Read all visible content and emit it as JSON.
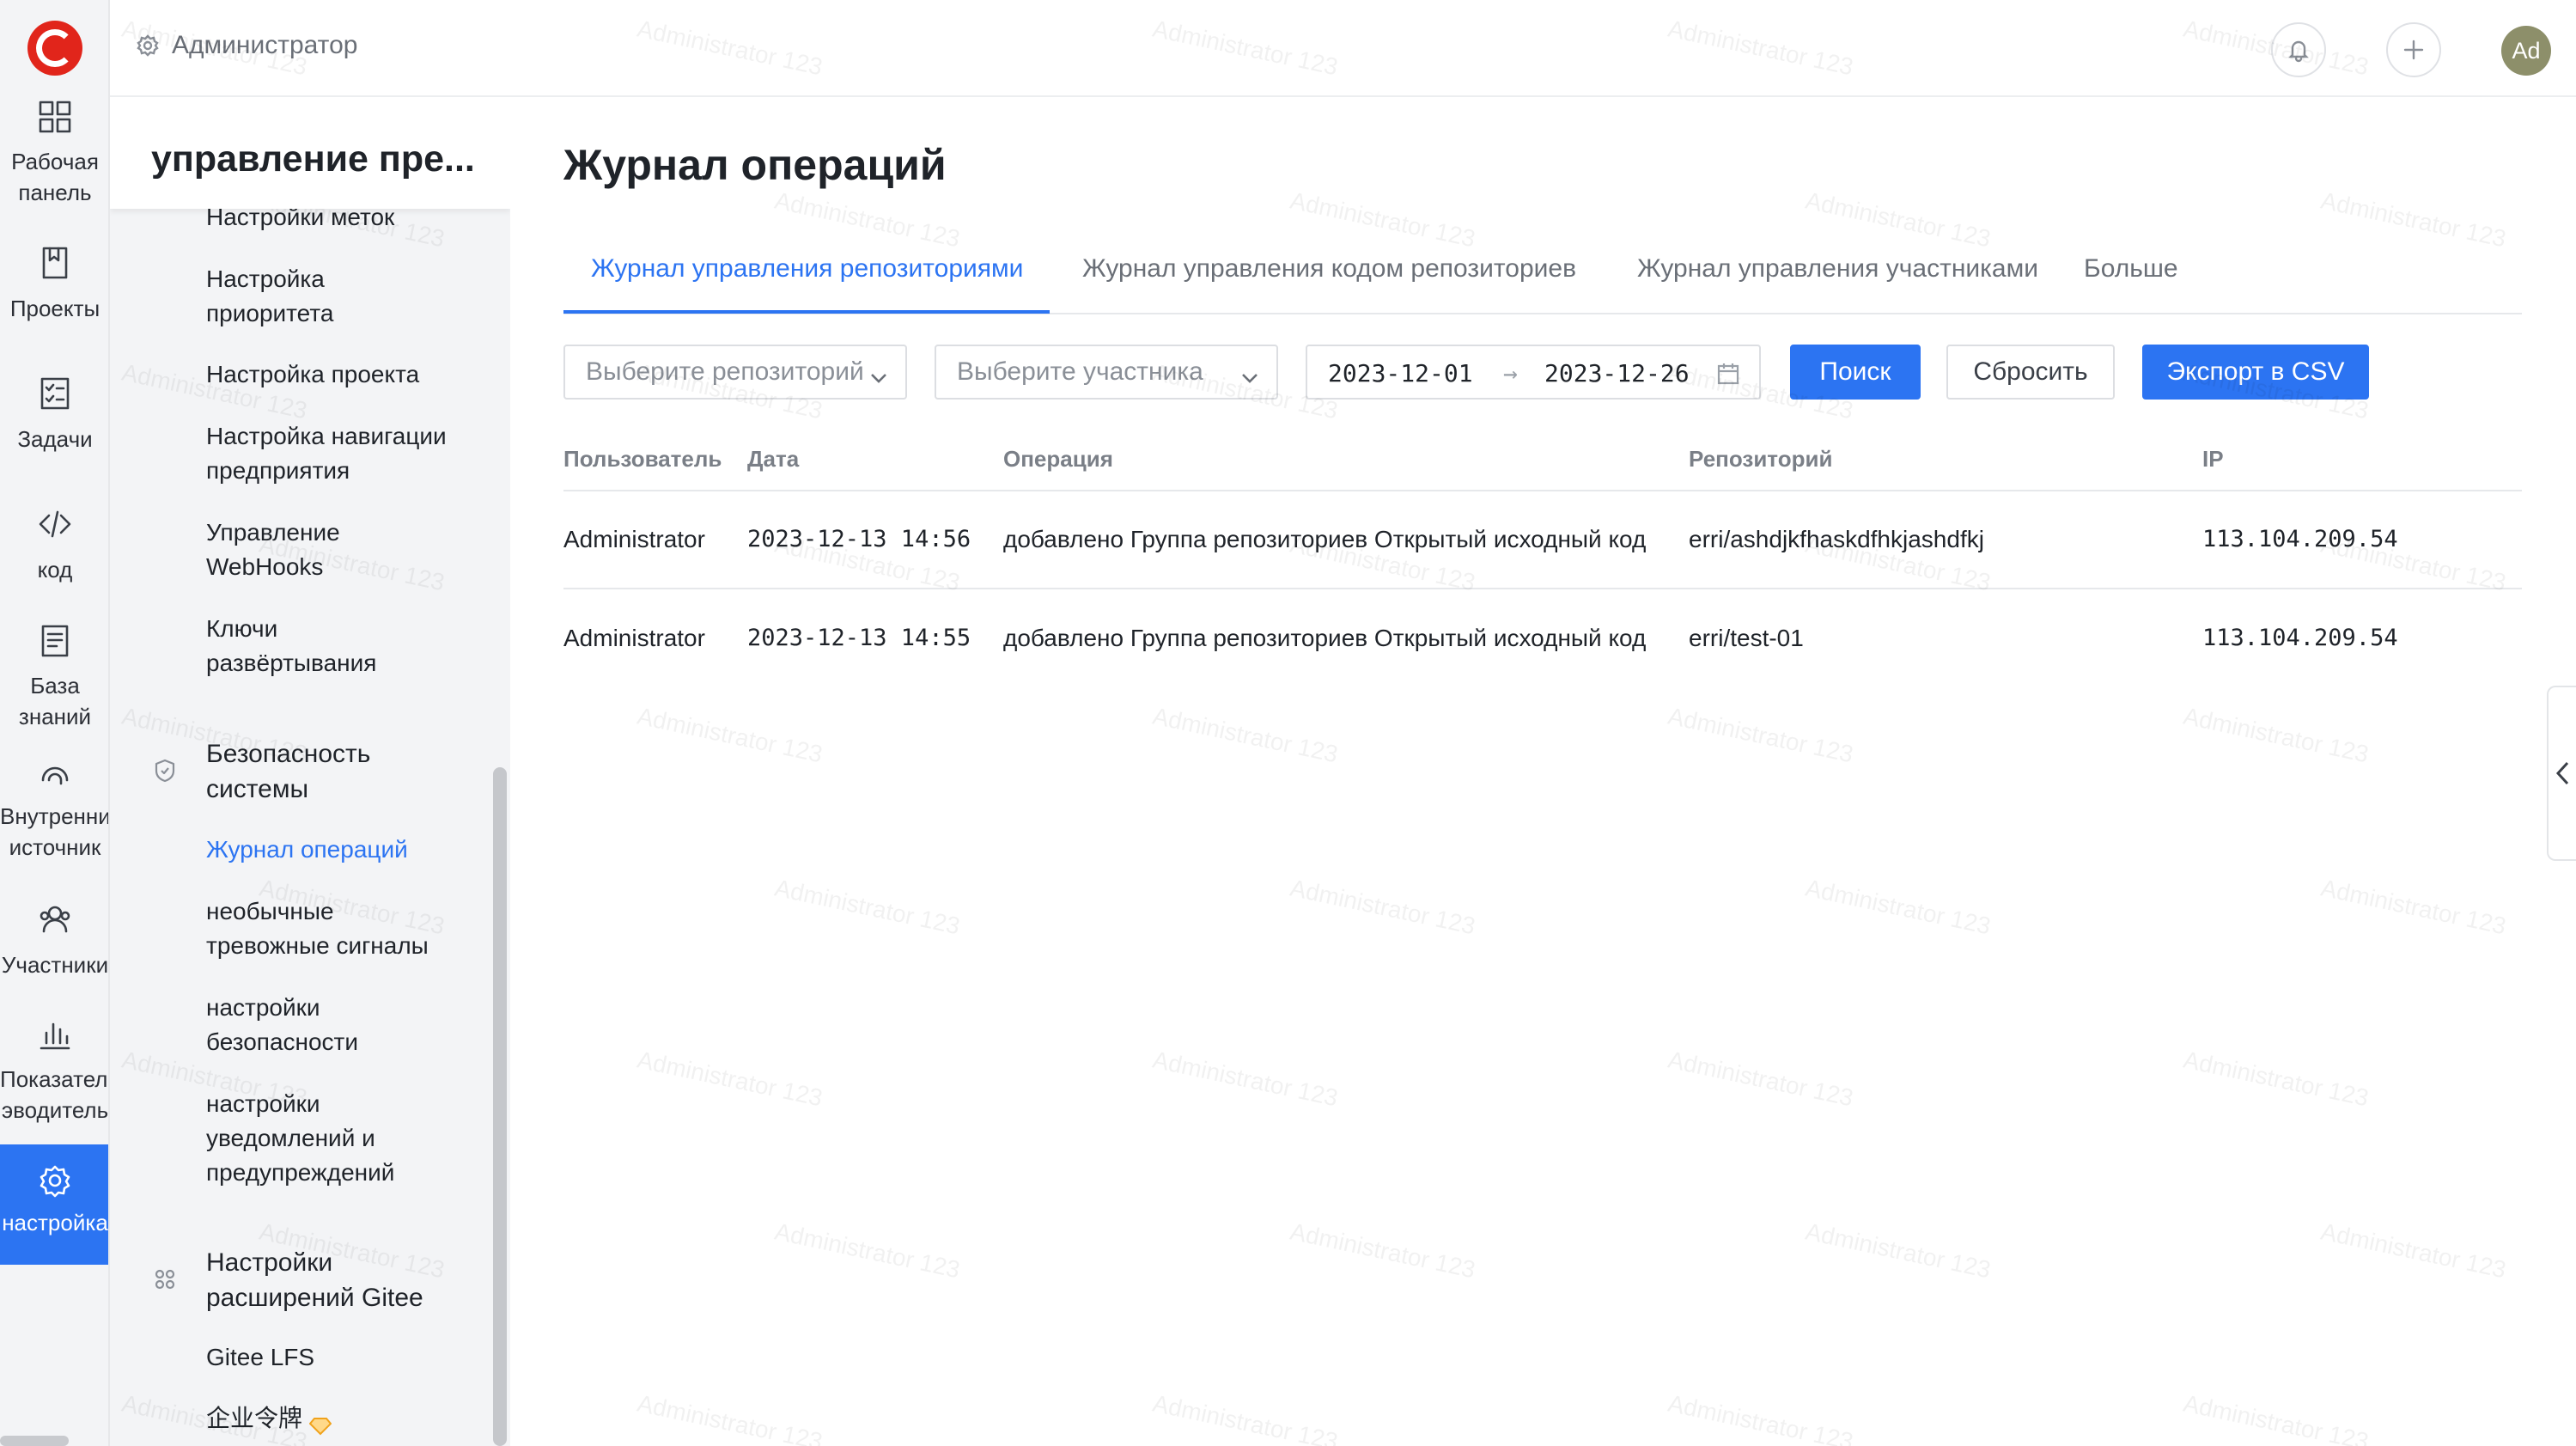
{
  "rail": {
    "items": [
      {
        "label": "Рабочая\nпанель",
        "icon": "dashboard-icon"
      },
      {
        "label": "Проекты",
        "icon": "book-icon"
      },
      {
        "label": "Задачи",
        "icon": "task-icon"
      },
      {
        "label": "код",
        "icon": "code-icon"
      },
      {
        "label": "База\nзнаний",
        "icon": "docs-icon"
      },
      {
        "label": "Внутренни\nисточник",
        "icon": "inner-source-icon"
      },
      {
        "label": "Участники",
        "icon": "members-icon"
      },
      {
        "label": "Показатели\nэводитель",
        "icon": "chart-icon"
      },
      {
        "label": "настройка",
        "icon": "gear-icon",
        "active": true
      }
    ]
  },
  "topbar": {
    "breadcrumb": "Администратор",
    "avatar": "Ad"
  },
  "sidebar": {
    "title": "управление пре...",
    "items": [
      {
        "label": "Настройки меток"
      },
      {
        "label": "Настройка\nприоритета"
      },
      {
        "label": "Настройка проекта"
      },
      {
        "label": "Настройка навигации\nпредприятия"
      },
      {
        "label": "Управление\nWebHooks"
      },
      {
        "label": "Ключи\nразвёртывания"
      },
      {
        "label": "Безопасность\nсистемы",
        "group": true
      },
      {
        "label": "Журнал операций",
        "active": true
      },
      {
        "label": "необычные\nтревожные сигналы"
      },
      {
        "label": "настройки\nбезопасности"
      },
      {
        "label": "настройки\nуведомлений и\nпредупреждений"
      },
      {
        "label": "Настройки\nрасширений Gitee",
        "group": true
      },
      {
        "label": "Gitee LFS"
      },
      {
        "label": "企业令牌"
      }
    ]
  },
  "main": {
    "title": "Журнал операций",
    "tabs": [
      {
        "label": "Журнал управления репозиториями",
        "active": true
      },
      {
        "label": "Журнал управления кодом репозиториев"
      },
      {
        "label": "Журнал управления участниками"
      },
      {
        "label": "Больше"
      }
    ],
    "filters": {
      "repo_placeholder": "Выберите репозиторий",
      "member_placeholder": "Выберите участника",
      "date_from": "2023-12-01",
      "date_to": "2023-12-26",
      "date_separator": "→",
      "search_label": "Поиск",
      "reset_label": "Сбросить",
      "export_label": "Экспорт в CSV"
    },
    "table": {
      "columns": [
        "Пользователь",
        "Дата",
        "Операция",
        "Репозиторий",
        "IP"
      ],
      "rows": [
        [
          "Administrator",
          "2023-12-13 14:56",
          "добавлено Группа репозиториев Открытый исходный код",
          "erri/ashdjkfhaskdfhkjashdfkj",
          "113.104.209.54"
        ],
        [
          "Administrator",
          "2023-12-13 14:55",
          "добавлено Группа репозиториев Открытый исходный код",
          "erri/test-01",
          "113.104.209.54"
        ]
      ]
    }
  },
  "watermark": "Administrator 123",
  "colors": {
    "accent": "#2c74f2",
    "logo": "#e1251b"
  }
}
